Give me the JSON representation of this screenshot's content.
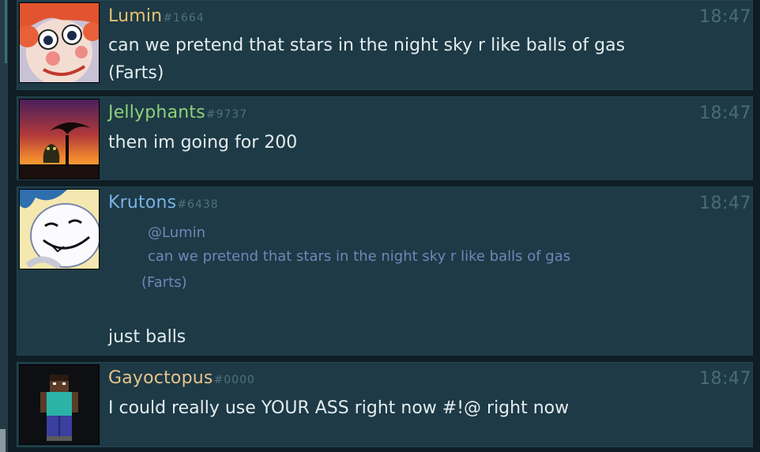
{
  "messages": [
    {
      "username": "Lumin",
      "discriminator": "#1664",
      "time": "18:47",
      "name_color": "#e8c070",
      "lines": [
        "can we pretend that stars in the night sky r like balls of gas",
        "(Farts)"
      ],
      "avatar": "raggedy-ann-avatar"
    },
    {
      "username": "Jellyphants",
      "discriminator": "#9737",
      "time": "18:47",
      "name_color": "#8fd27a",
      "lines": [
        "then im going for 200"
      ],
      "avatar": "sunset-silhouette-avatar"
    },
    {
      "username": "Krutons",
      "discriminator": "#6438",
      "time": "18:47",
      "name_color": "#79b3e6",
      "quote": {
        "mention": "@Lumin",
        "line1": "can we pretend that stars in the night sky r like balls of gas",
        "line2": "(Farts)"
      },
      "lines": [
        "just balls"
      ],
      "avatar": "cartoon-face-avatar"
    },
    {
      "username": "Gayoctopus",
      "discriminator": "#0000",
      "time": "18:47",
      "name_color": "#e6c48a",
      "lines": [
        "I could really use YOUR ASS right now #!@ right now"
      ],
      "avatar": "pixel-character-avatar"
    }
  ]
}
